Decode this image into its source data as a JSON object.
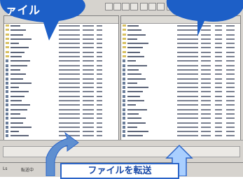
{
  "callout": {
    "banner": "ァイル"
  },
  "caption": {
    "label": "ファイルを転送"
  },
  "status": {
    "left": "Ls",
    "mid": "転送中"
  },
  "colors": {
    "bubble": "#1d5fc7",
    "arrow_left": "#5f8fd0",
    "arrow_right": "#a9cfff"
  }
}
